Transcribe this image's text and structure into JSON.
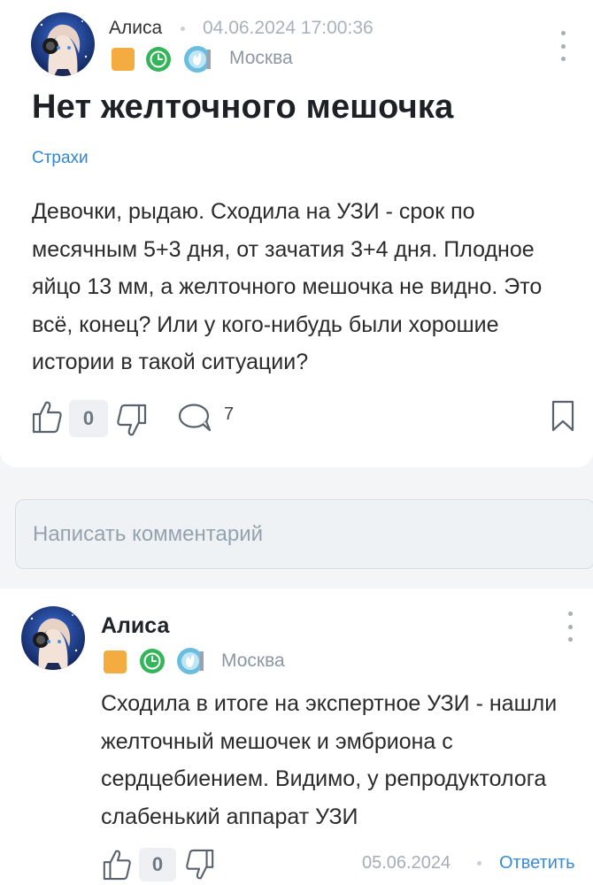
{
  "post": {
    "author": "Алиса",
    "timestamp": "04.06.2024 17:00:36",
    "city": "Москва",
    "title": "Нет желточного мешочка",
    "category": "Страхи",
    "body": "Девочки, рыдаю. Сходила на УЗИ - срок по месячным 5+3 дня, от зачатия 3+4 дня. Плодное яйцо 13 мм, а желточного мешочка не видно. Это всё, конец? Или у кого-нибудь были хорошие истории в такой ситуации?",
    "score": "0",
    "comments_count": "7"
  },
  "comment_input": {
    "placeholder": "Написать комментарий"
  },
  "comment": {
    "author": "Алиса",
    "city": "Москва",
    "body": "Сходила в итоге на экспертное УЗИ - нашли желточный мешочек и эмбриона с сердцебиением. Видимо, у репродуктолога слабенький аппарат УЗИ",
    "score": "0",
    "date": "05.06.2024",
    "reply_label": "Ответить"
  },
  "colors": {
    "accent_link": "#2f86d6",
    "badge_orange": "#f4ab3f",
    "badge_green": "#35b55a",
    "badge_blue": "#6bbde0"
  },
  "icons": [
    "avatar",
    "badge-square",
    "clock-icon",
    "hand-icon",
    "kebab-menu-icon",
    "thumb-up-icon",
    "thumb-down-icon",
    "comment-icon",
    "bookmark-icon"
  ]
}
